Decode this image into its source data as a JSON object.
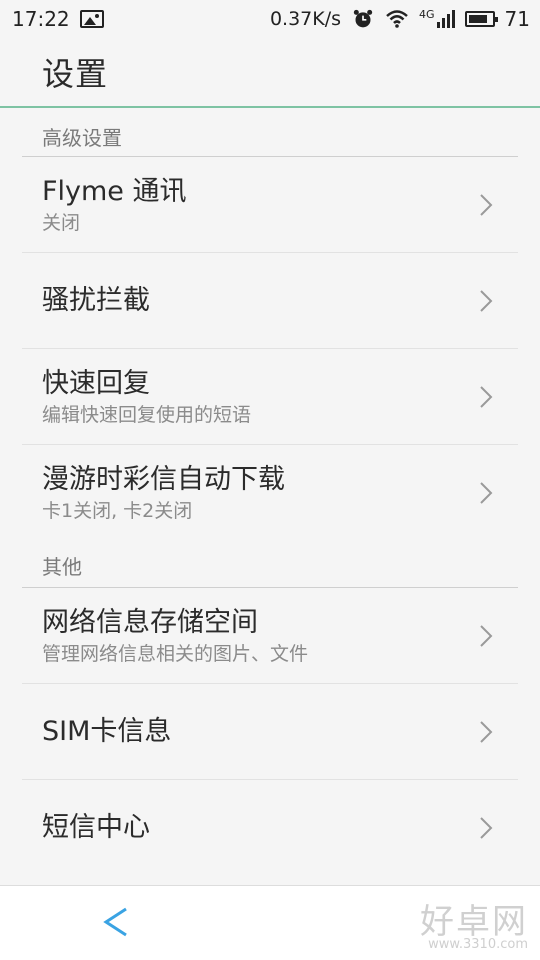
{
  "status_bar": {
    "time": "17:22",
    "network_speed": "0.37K/s",
    "signal_label": "4G",
    "battery": "71",
    "icons": [
      "image-icon",
      "alarm-icon",
      "wifi-icon",
      "signal-icon",
      "battery-icon"
    ]
  },
  "header": {
    "title": "设置"
  },
  "sections": [
    {
      "title": "高级设置",
      "items": [
        {
          "title": "Flyme 通讯",
          "subtitle": "关闭"
        },
        {
          "title": "骚扰拦截",
          "subtitle": ""
        },
        {
          "title": "快速回复",
          "subtitle": "编辑快速回复使用的短语"
        },
        {
          "title": "漫游时彩信自动下载",
          "subtitle": "卡1关闭, 卡2关闭"
        }
      ]
    },
    {
      "title": "其他",
      "items": [
        {
          "title": "网络信息存储空间",
          "subtitle": "管理网络信息相关的图片、文件"
        },
        {
          "title": "SIM卡信息",
          "subtitle": ""
        },
        {
          "title": "短信中心",
          "subtitle": ""
        }
      ]
    }
  ],
  "watermark": {
    "text": "好卓网",
    "url": "www.3310.com"
  },
  "colors": {
    "accent_line": "#7ec3a3",
    "back_arrow": "#3aa3e3"
  }
}
